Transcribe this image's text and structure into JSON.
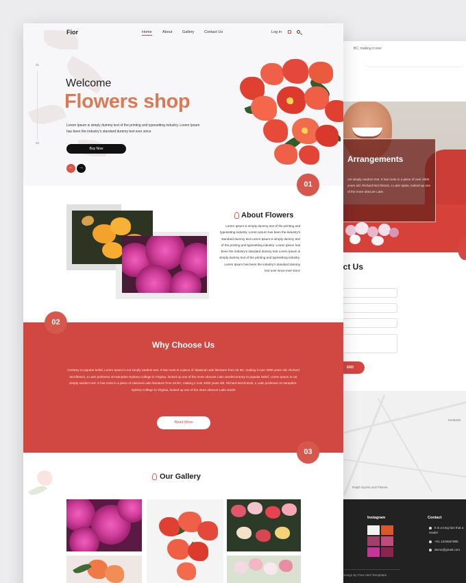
{
  "colors": {
    "accent": "#d6574c",
    "section": "#d04841",
    "title_orange": "#d97a55",
    "dark": "#111111",
    "footer": "#222222"
  },
  "nav": {
    "logo": "Fior",
    "items": [
      "Home",
      "About",
      "Gallery",
      "Contact Us"
    ],
    "login": "Log in",
    "cart_icon": "cart-icon",
    "search_icon": "search-icon"
  },
  "hero": {
    "slide_numbers": [
      "01",
      "02"
    ],
    "welcome": "Welcome",
    "title": "Flowers shop",
    "text": "Lorem Ipsum is simply dummy text of the printing and typesetting industry. Lorem Ipsum has been the industry's standard dummy text ever since",
    "buy_button": "Buy Now"
  },
  "sections": {
    "about": {
      "number": "01",
      "title": "About Flowers",
      "text": "Lorem Ipsum is simply dummy text of the printing and typesetting industry. Lorem Ipsum has been the industry's standard dummy text Lorem Ipsum is simply dummy text of the printing and typesetting industry. Lorem Ipsum has been the industry's standard dummy text Lorem Ipsum is simply dummy text of the printing and typesetting industry. Lorem Ipsum has been the industry's standard dummy text ever since ever since"
    },
    "why": {
      "number": "02",
      "title": "Why Choose Us",
      "text": "Contrary to popular belief, Lorem Ipsum is not simply random text. It has roots in a piece of classical Latin literature from 45 BC, making it over 2000 years old. Richard McClintock, a Latin professor at Hampden-Sydney College in Virginia, looked up one of the more obscure Latin wordsContrary to popular belief, Lorem Ipsum is not simply random text. It has roots in a piece of classical Latin literature from 45 BC, making it over 2000 years old. Richard McClintock, a Latin professor at Hampden-Sydney College in Virginia, looked up one of the more obscure Latin words",
      "read_more": "Read More"
    },
    "gallery": {
      "number": "03",
      "title": "Our Gallery"
    }
  },
  "back_page": {
    "top_text": "BC, making it over",
    "arrangements_title": "Arrangements",
    "arrangements_text": "not simply random text. It has roots in a piece of over 2000 years old. Richard McClintock, a Latin rginia, looked up one of the more obscure Latin",
    "contact_title": "act Us",
    "send_button": "END",
    "map_label_1": "Kimberle",
    "map_label_2": "Ralph Sports and Fitness",
    "footer": {
      "instagram": "Instagram",
      "contact": "Contact",
      "address": "It is a long fact that a reader",
      "phone": "+01 1234567890",
      "email": "demo@gmail.com",
      "copyright": "Design by Free Html Templates"
    }
  }
}
